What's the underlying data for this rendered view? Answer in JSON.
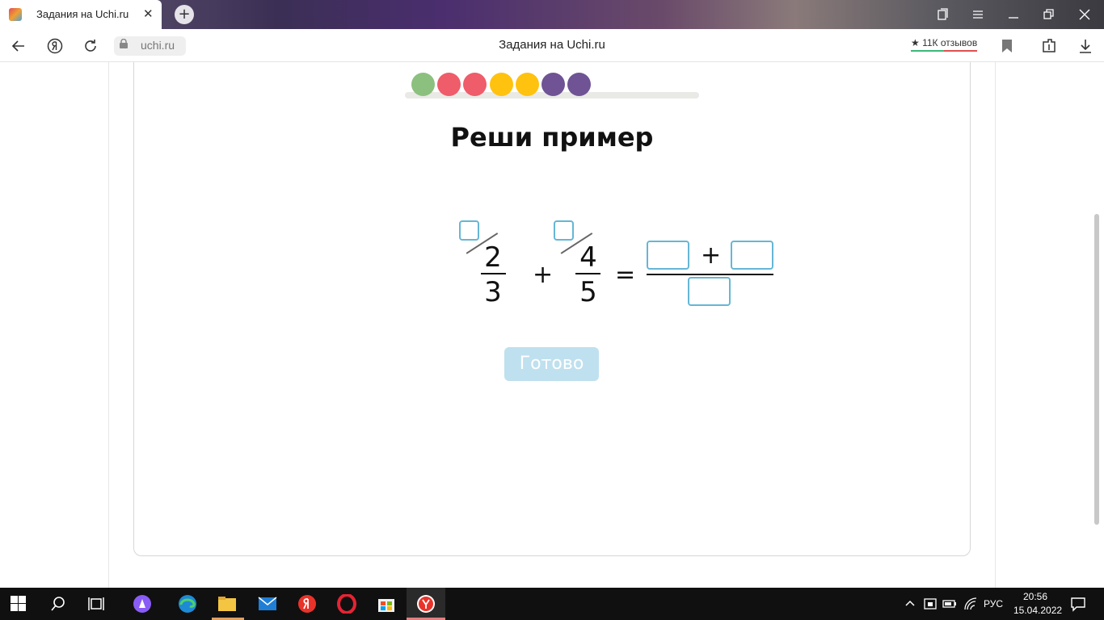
{
  "browser": {
    "tab_title": "Задания на Uchi.ru",
    "tab_close": "✕",
    "new_tab": "+",
    "url": "uchi.ru",
    "page_title": "Задания на Uchi.ru",
    "reviews": "★ 11К отзывов"
  },
  "progress": {
    "dots": [
      {
        "color": "#8cc07e"
      },
      {
        "color": "#ef5c6a"
      },
      {
        "color": "#ef5c6a"
      },
      {
        "color": "#ffc20e"
      },
      {
        "color": "#ffc20e"
      },
      {
        "color": "#6f5394"
      },
      {
        "color": "#6f5394"
      }
    ]
  },
  "task": {
    "heading": "Реши пример",
    "fraction1": {
      "numerator": "2",
      "denominator": "3"
    },
    "fraction2": {
      "numerator": "4",
      "denominator": "5"
    },
    "plus": "+",
    "equals": "=",
    "result_plus": "+",
    "done_label": "Готово"
  },
  "taskbar": {
    "language": "РУС",
    "time": "20:56",
    "date": "15.04.2022"
  },
  "colors": {
    "input_border": "#66b6d6",
    "done_button": "#bfe0ef"
  }
}
